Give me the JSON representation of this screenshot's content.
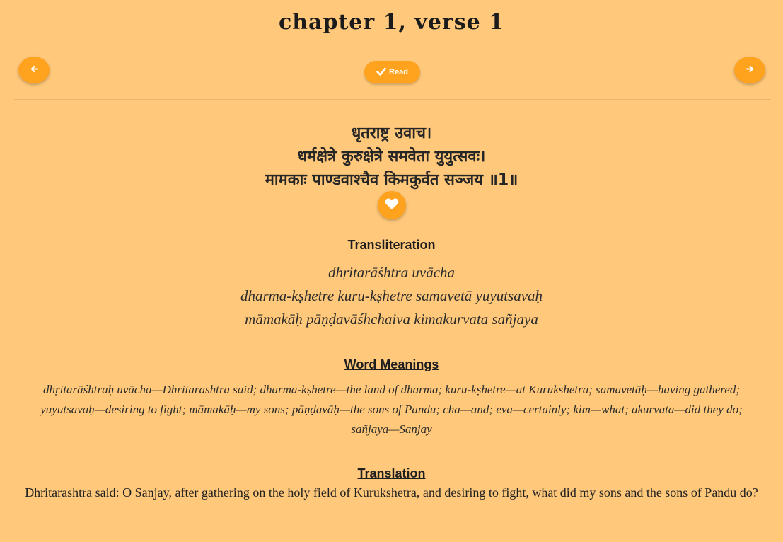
{
  "header": {
    "title": "chapter 1, verse 1",
    "read_label": "Read"
  },
  "verse": {
    "sanskrit_lines": [
      "धृतराष्ट्र उवाच।",
      "धर्मक्षेत्रे कुरुक्षेत्रे समवेता युयुत्सवः।",
      "मामकाः पाण्डवाश्चैव किमकुर्वत सञ्जय ॥1॥"
    ]
  },
  "transliteration": {
    "heading": "Transliteration",
    "lines": [
      "dhṛitarāśhtra uvācha",
      "dharma-kṣhetre kuru-kṣhetre samavetā yuyutsavaḥ",
      "māmakāḥ pāṇḍavāśhchaiva kimakurvata sañjaya"
    ]
  },
  "word_meanings": {
    "heading": "Word Meanings",
    "text": "dhṛitarāśhtraḥ uvācha—Dhritarashtra said; dharma-kṣhetre—the land of dharma; kuru-kṣhetre—at Kurukshetra; samavetāḥ—having gathered; yuyutsavaḥ—desiring to fight; māmakāḥ—my sons; pāṇḍavāḥ—the sons of Pandu; cha—and; eva—certainly; kim—what; akurvata—did they do; sañjaya—Sanjay"
  },
  "translation": {
    "heading": "Translation",
    "text": "Dhritarashtra said: O Sanjay, after gathering on the holy field of Kurukshetra, and desiring to fight, what did my sons and the sons of Pandu do?"
  },
  "icons": {
    "prev": "arrow-left-icon",
    "next": "arrow-right-icon",
    "read": "check-icon",
    "favorite": "heart-icon"
  },
  "colors": {
    "background": "#ffc87a",
    "accent": "#ffa31f"
  }
}
